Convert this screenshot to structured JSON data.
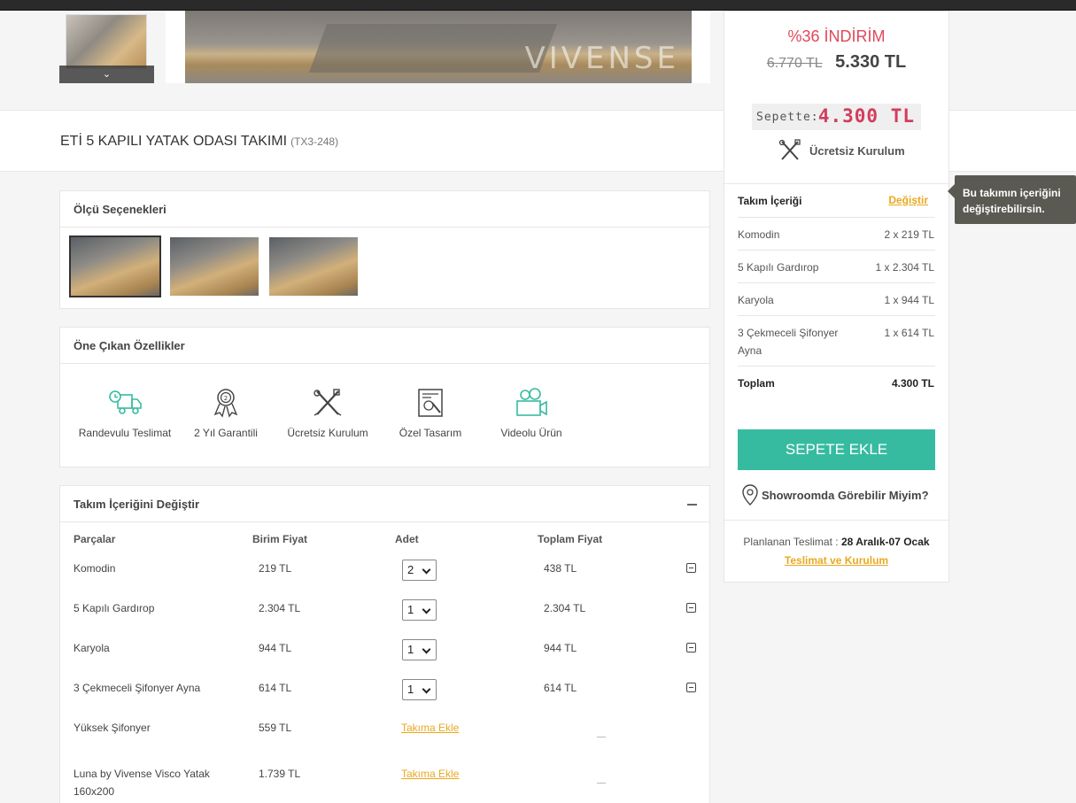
{
  "gallery": {
    "watermark": "VIVENSE",
    "thumb_down": "⌄"
  },
  "product": {
    "title": "ETİ 5 KAPILI YATAK ODASI TAKIMI",
    "code": "(TX3-248)"
  },
  "size_options": {
    "title": "Ölçü Seçenekleri",
    "selected_index": 0
  },
  "features": {
    "title": "Öne Çıkan Özellikler",
    "items": [
      {
        "label": "Randevulu Teslimat",
        "icon": "delivery-truck-icon"
      },
      {
        "label": "2 Yıl Garantili",
        "icon": "warranty-badge-icon"
      },
      {
        "label": "Ücretsiz Kurulum",
        "icon": "tools-icon"
      },
      {
        "label": "Özel Tasarım",
        "icon": "design-icon"
      },
      {
        "label": "Videolu Ürün",
        "icon": "video-camera-icon"
      }
    ]
  },
  "set_editor": {
    "title": "Takım İçeriğini Değiştir",
    "headers": {
      "part": "Parçalar",
      "unit_price": "Birim Fiyat",
      "qty": "Adet",
      "total": "Toplam Fiyat"
    },
    "rows": [
      {
        "name": "Komodin",
        "unit": "219 TL",
        "qty": "2",
        "total": "438 TL"
      },
      {
        "name": "5 Kapılı Gardırop",
        "unit": "2.304 TL",
        "qty": "1",
        "total": "2.304 TL"
      },
      {
        "name": "Karyola",
        "unit": "944 TL",
        "qty": "1",
        "total": "944 TL"
      },
      {
        "name": "3 Çekmeceli Şifonyer Ayna",
        "unit": "614 TL",
        "qty": "1",
        "total": "614 TL"
      }
    ],
    "optional_rows": [
      {
        "name": "Yüksek Şifonyer",
        "unit": "559 TL",
        "action": "Takıma Ekle"
      },
      {
        "name_line1": "Luna by Vivense Visco Yatak",
        "name_line2": "160x200",
        "unit": "1.739 TL",
        "action": "Takıma Ekle"
      }
    ]
  },
  "sidebar": {
    "discount": "%36 İNDİRİM",
    "old_price": "6.770 TL",
    "new_price": "5.330 TL",
    "basket_label": "Sepette:",
    "basket_price": "4.300 TL",
    "install_label": "Ücretsiz Kurulum",
    "set_contents_label": "Takım İçeriği",
    "change_label": "Değiştir",
    "items": [
      {
        "name": "Komodin",
        "value": "2 x 219 TL"
      },
      {
        "name": "5 Kapılı Gardırop",
        "value": "1 x 2.304 TL"
      },
      {
        "name": "Karyola",
        "value": "1 x 944 TL"
      },
      {
        "name_line1": "3 Çekmeceli Şifonyer",
        "name_line2": "Ayna",
        "value": "1 x 614 TL"
      }
    ],
    "total_label": "Toplam",
    "total_value": "4.300 TL",
    "cart_button": "SEPETE EKLE",
    "showroom": "Showroomda Görebilir Miyim?",
    "delivery_label": "Planlanan Teslimat :",
    "delivery_dates": "28 Aralık-07 Ocak",
    "delivery_link": "Teslimat ve Kurulum"
  },
  "tooltip": {
    "line1": "Bu takımın içeriğini",
    "line2": "değiştirebilirsin."
  },
  "colors": {
    "accent_green": "#37bba0",
    "discount_red": "#e0485a",
    "basket_red": "#d23d5d",
    "link_orange": "#e9a81f"
  }
}
